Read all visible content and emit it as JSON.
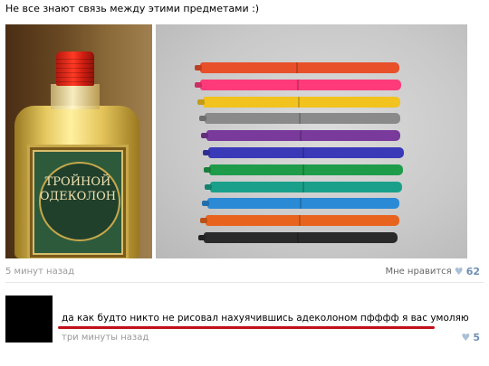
{
  "post": {
    "text": "Не все знают связь между этими предметами :)",
    "time": "5 минут назад",
    "like_label": "Мне нравится",
    "like_count": "62"
  },
  "photo_left": {
    "label_line1": "ТРОЙНОЙ",
    "label_line2": "ОДЕКОЛОН"
  },
  "markers": {
    "colors": [
      "#e8502a",
      "#ff3a7a",
      "#f2c21e",
      "#8a8a8a",
      "#7a3a9c",
      "#3a3ab8",
      "#1f9c4a",
      "#1aa08a",
      "#2a8ad6",
      "#e8641e",
      "#2a2a2a"
    ]
  },
  "comment": {
    "text": "да как будто никто не рисовал нахуячившись адеколоном пфффф я вас умоляю",
    "time": "три минуты назад",
    "like_count": "5"
  },
  "colors": {
    "accent": "#6f8fb3",
    "underline": "#c0101a"
  }
}
